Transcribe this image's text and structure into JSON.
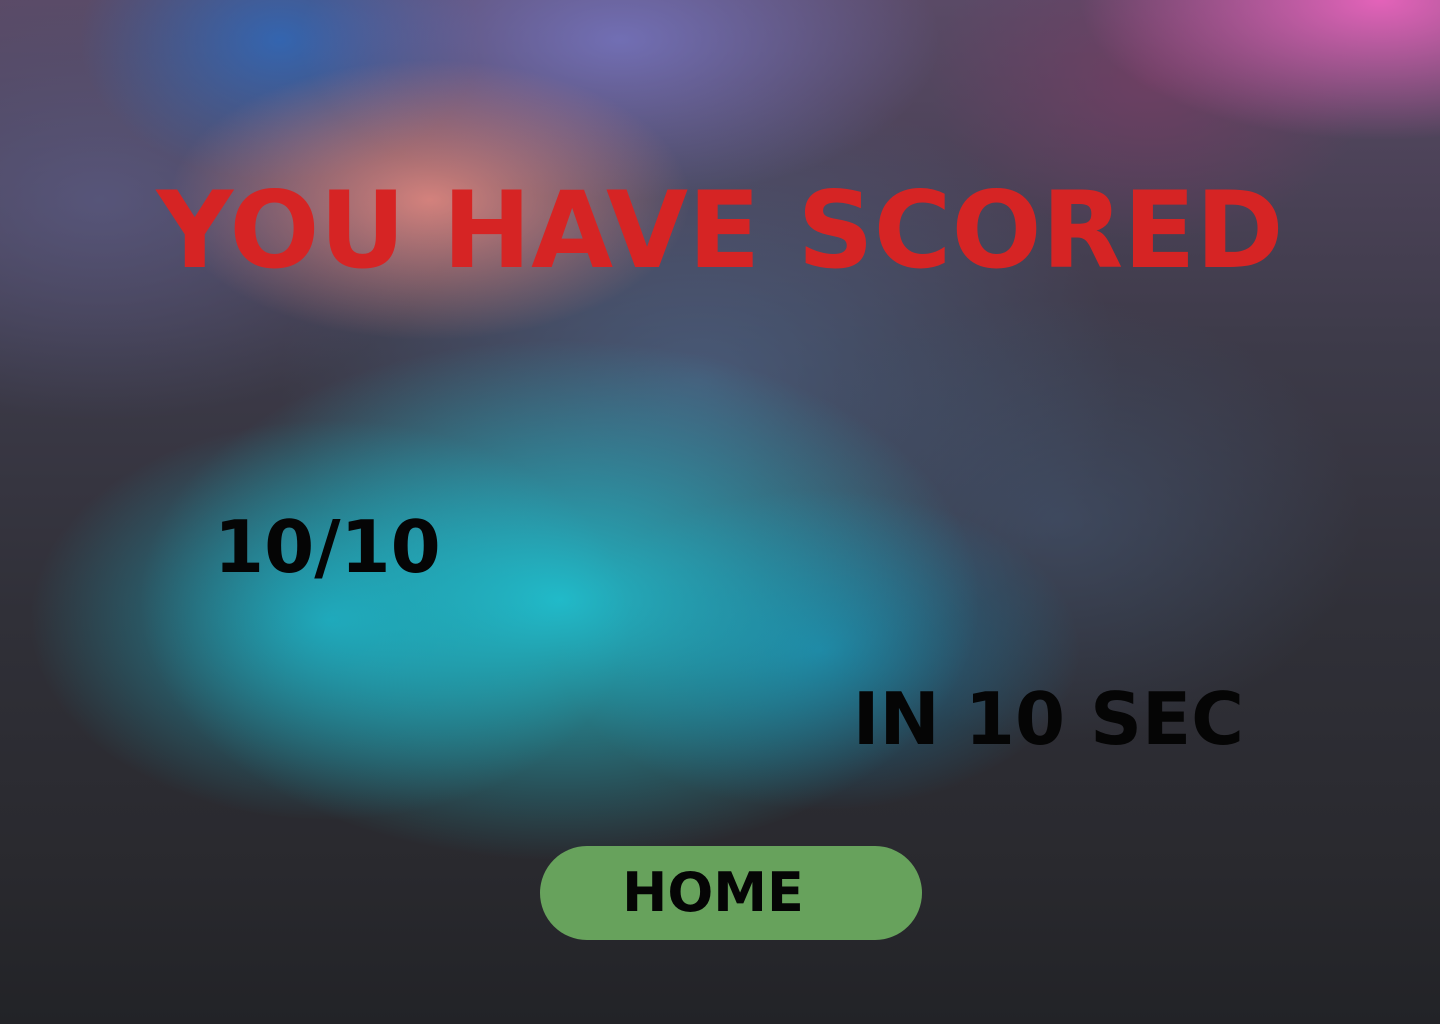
{
  "result": {
    "title": "YOU HAVE SCORED",
    "score": "10/10",
    "time": "IN 10 SEC"
  },
  "actions": {
    "home_label": "HOME"
  },
  "colors": {
    "title": "#d62424",
    "text": "#050505",
    "home_button": "#67a25c"
  }
}
